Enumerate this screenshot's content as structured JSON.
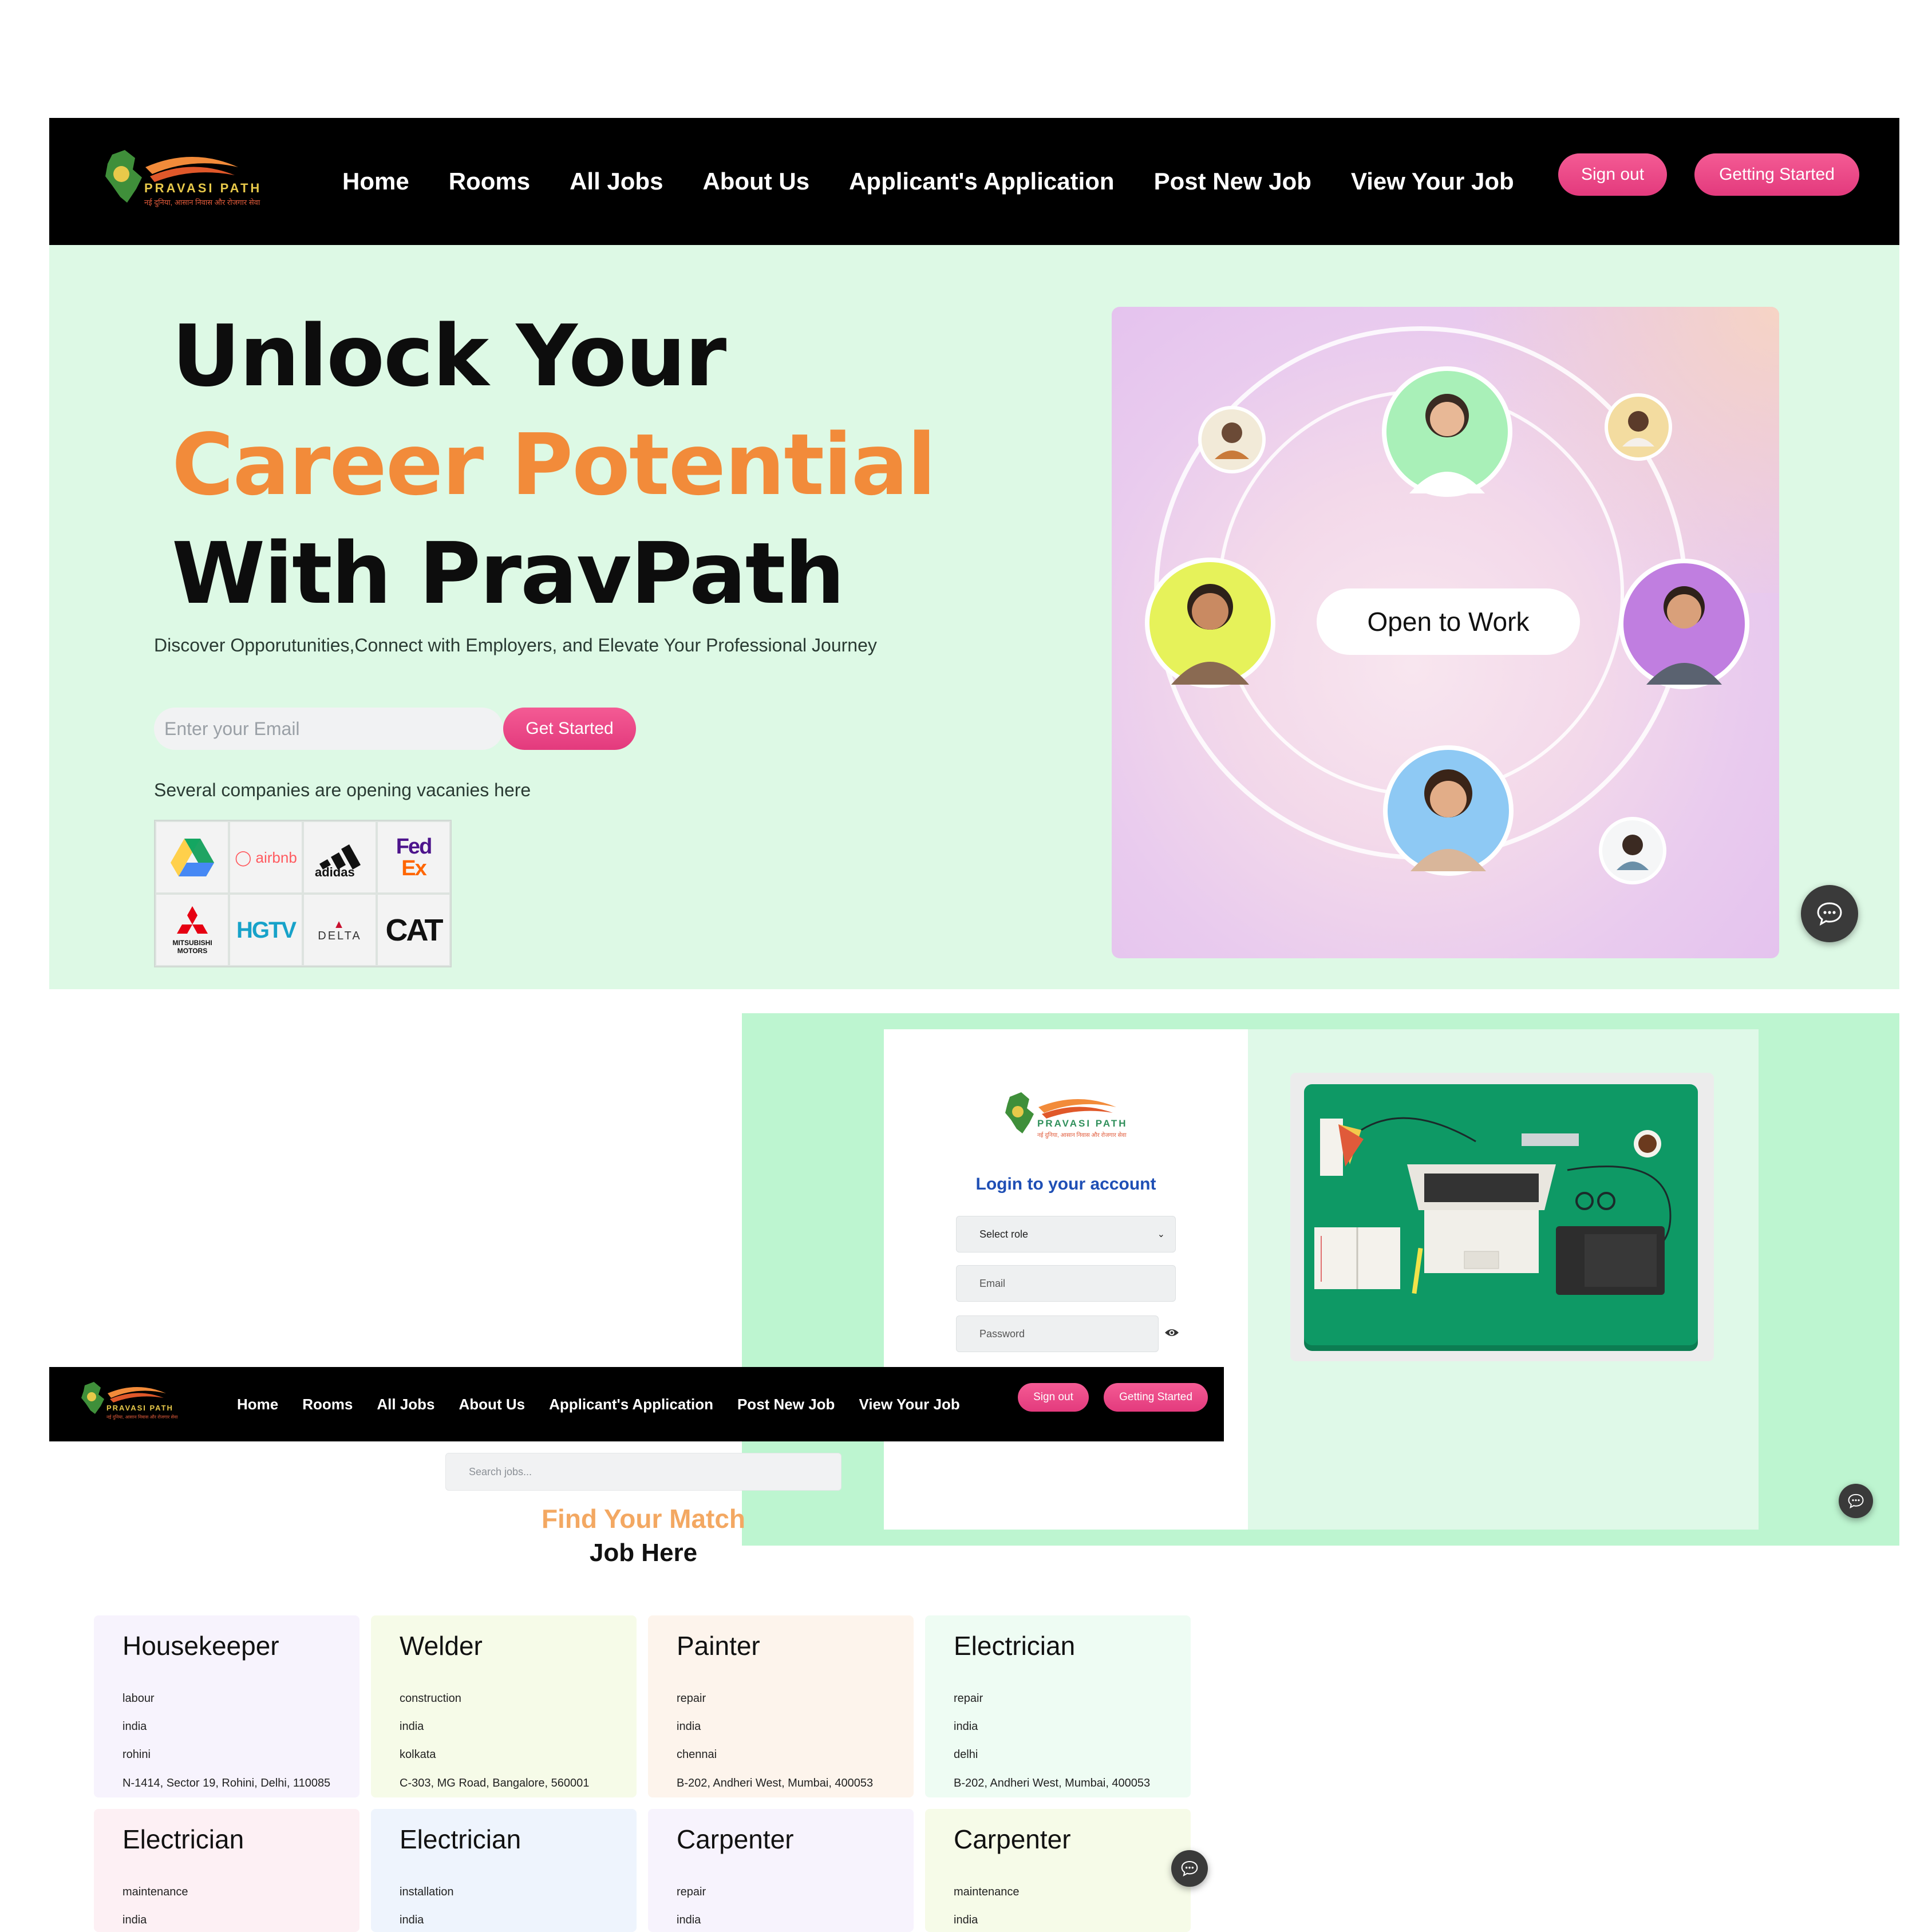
{
  "brand": {
    "logo_text": "PRAVASI PATH",
    "tagline": "नई दुनिया, आसान निवास और रोजगार सेवा"
  },
  "nav": {
    "links": [
      "Home",
      "Rooms",
      "All Jobs",
      "About Us",
      "Applicant's Application",
      "Post New Job",
      "View Your Job"
    ],
    "sign_out": "Sign out",
    "getting_started": "Getting Started"
  },
  "hero": {
    "line1": "Unlock Your",
    "line2": "Career Potential",
    "line3": "With PravPath",
    "subtitle": "Discover Opporutunities,Connect with Employers, and Elevate Your Professional Journey",
    "email_placeholder": "Enter your Email",
    "cta": "Get Started",
    "companies_text": "Several companies are opening vacanies here",
    "companies": [
      "Google Drive",
      "airbnb",
      "adidas",
      "FedEx",
      "MITSUBISHI MOTORS",
      "HGTV",
      "DELTA",
      "CAT"
    ],
    "image_badge": "Open to Work"
  },
  "login": {
    "title": "Login to your account",
    "role_placeholder": "Select role",
    "email_placeholder": "Email",
    "password_placeholder": "Password"
  },
  "jobs_page": {
    "search_placeholder": "Search jobs...",
    "heading_1": "Find Your Match",
    "heading_2": "Job Here",
    "jobs": [
      {
        "title": "Housekeeper",
        "category": "labour",
        "country": "india",
        "city": "rohini",
        "address": "N-1414, Sector 19, Rohini, Delhi, 110085"
      },
      {
        "title": "Welder",
        "category": "construction",
        "country": "india",
        "city": "kolkata",
        "address": "C-303, MG Road, Bangalore, 560001"
      },
      {
        "title": "Painter",
        "category": "repair",
        "country": "india",
        "city": "chennai",
        "address": "B-202, Andheri West, Mumbai, 400053"
      },
      {
        "title": "Electrician",
        "category": "repair",
        "country": "india",
        "city": "delhi",
        "address": "B-202, Andheri West, Mumbai, 400053"
      },
      {
        "title": "Electrician",
        "category": "maintenance",
        "country": "india"
      },
      {
        "title": "Electrician",
        "category": "installation",
        "country": "india"
      },
      {
        "title": "Carpenter",
        "category": "repair",
        "country": "india"
      },
      {
        "title": "Carpenter",
        "category": "maintenance",
        "country": "india"
      }
    ]
  },
  "colors": {
    "accent_pink": "#e33a7d",
    "accent_orange": "#f28b3a",
    "hero_bg": "#ddf9e5",
    "login_bg": "#bdf5d0"
  }
}
